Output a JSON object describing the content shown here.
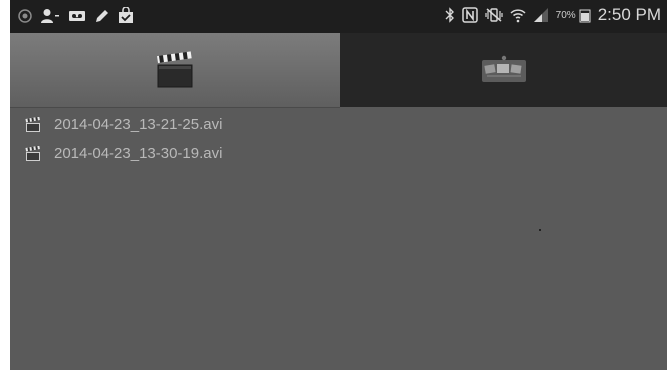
{
  "status_bar": {
    "time": "2:50 PM",
    "battery_percent": "70%",
    "left_icons": [
      "record-icon",
      "person-add-icon",
      "voicemail-icon",
      "pencil-icon",
      "bag-check-icon"
    ],
    "right_icons": [
      "bluetooth-icon",
      "nfc-icon",
      "vibrate-mute-icon",
      "wifi-icon",
      "signal-icon",
      "battery-icon"
    ]
  },
  "tabs": [
    {
      "id": "videos",
      "icon": "clapperboard-icon",
      "selected": true
    },
    {
      "id": "gallery",
      "icon": "photo-album-icon",
      "selected": false
    }
  ],
  "files": [
    {
      "name": "2014-04-23_13-21-25.avi",
      "icon": "clapperboard-icon"
    },
    {
      "name": "2014-04-23_13-30-19.avi",
      "icon": "clapperboard-icon"
    }
  ],
  "colors": {
    "background": "#5a5a5a",
    "status_bar": "#1e1e1e",
    "tab_selected": "#6e6e6e",
    "tab_unselected": "#262626",
    "file_text": "#b9b9b9"
  }
}
